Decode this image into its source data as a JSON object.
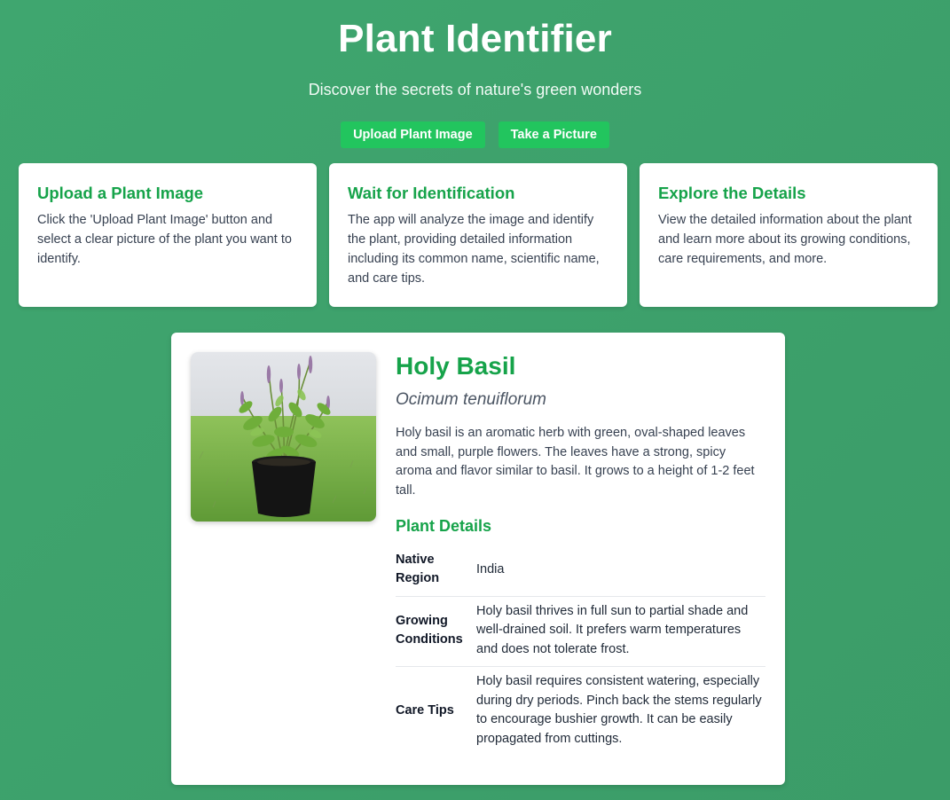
{
  "header": {
    "title": "Plant Identifier",
    "subtitle": "Discover the secrets of nature's green wonders"
  },
  "actions": {
    "upload_label": "Upload Plant Image",
    "camera_label": "Take a Picture"
  },
  "steps": [
    {
      "title": "Upload a Plant Image",
      "text": "Click the 'Upload Plant Image' button and select a clear picture of the plant you want to identify."
    },
    {
      "title": "Wait for Identification",
      "text": "The app will analyze the image and identify the plant, providing detailed information including its common name, scientific name, and care tips."
    },
    {
      "title": "Explore the Details",
      "text": "View the detailed information about the plant and learn more about its growing conditions, care requirements, and more."
    }
  ],
  "result": {
    "common_name": "Holy Basil",
    "scientific_name": "Ocimum tenuiflorum",
    "description": "Holy basil is an aromatic herb with green, oval-shaped leaves and small, purple flowers. The leaves have a strong, spicy aroma and flavor similar to basil. It grows to a height of 1-2 feet tall.",
    "details_title": "Plant Details",
    "details": [
      {
        "key": "Native Region",
        "value": "India"
      },
      {
        "key": "Growing Conditions",
        "value": "Holy basil thrives in full sun to partial shade and well-drained soil. It prefers warm temperatures and does not tolerate frost."
      },
      {
        "key": "Care Tips",
        "value": "Holy basil requires consistent watering, especially during dry periods. Pinch back the stems regularly to encourage bushier growth. It can be easily propagated from cuttings."
      }
    ]
  },
  "colors": {
    "background": "#3fa66f",
    "accent": "#16a34a",
    "button": "#22c55e"
  }
}
